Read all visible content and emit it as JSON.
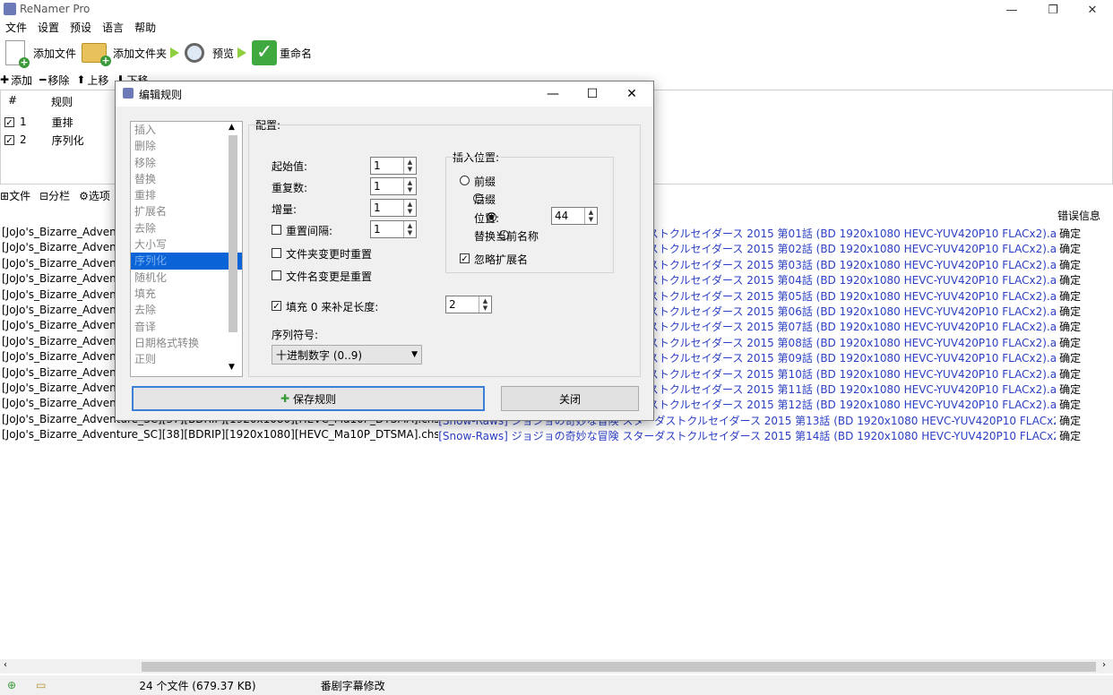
{
  "window": {
    "title": "ReNamer Pro"
  },
  "menu": [
    "文件",
    "设置",
    "预设",
    "语言",
    "帮助"
  ],
  "toolbar": {
    "add_files": "添加文件",
    "add_folder": "添加文件夹",
    "preview": "预览",
    "rename": "重命名"
  },
  "rules_toolbar": {
    "add": "添加",
    "remove": "移除",
    "up": "上移",
    "down": "下移"
  },
  "rules_table": {
    "col_num": "#",
    "col_rule": "规则",
    "rows": [
      {
        "num": "1",
        "rule": "重排"
      },
      {
        "num": "2",
        "rule": "序列化"
      }
    ]
  },
  "files_toolbar": {
    "files": "文件",
    "columns": "分栏",
    "options": "选项"
  },
  "files_table": {
    "col_error": "错误信息",
    "rows": [
      {
        "old": "[JoJo's_Bizarre_Advent",
        "new": "ストクルセイダース 2015 第01話 (BD 1920x1080 HEVC-YUV420P10 FLACx2).ass",
        "status": "确定"
      },
      {
        "old": "[JoJo's_Bizarre_Advent",
        "new": "ストクルセイダース 2015 第02話 (BD 1920x1080 HEVC-YUV420P10 FLACx2).ass",
        "status": "确定"
      },
      {
        "old": "[JoJo's_Bizarre_Advent",
        "new": "ストクルセイダース 2015 第03話 (BD 1920x1080 HEVC-YUV420P10 FLACx2).ass",
        "status": "确定"
      },
      {
        "old": "[JoJo's_Bizarre_Advent",
        "new": "ストクルセイダース 2015 第04話 (BD 1920x1080 HEVC-YUV420P10 FLACx2).ass",
        "status": "确定"
      },
      {
        "old": "[JoJo's_Bizarre_Advent",
        "new": "ストクルセイダース 2015 第05話 (BD 1920x1080 HEVC-YUV420P10 FLACx2).ass",
        "status": "确定"
      },
      {
        "old": "[JoJo's_Bizarre_Advent",
        "new": "ストクルセイダース 2015 第06話 (BD 1920x1080 HEVC-YUV420P10 FLACx2).ass",
        "status": "确定"
      },
      {
        "old": "[JoJo's_Bizarre_Advent",
        "new": "ストクルセイダース 2015 第07話 (BD 1920x1080 HEVC-YUV420P10 FLACx2).ass",
        "status": "确定"
      },
      {
        "old": "[JoJo's_Bizarre_Advent",
        "new": "ストクルセイダース 2015 第08話 (BD 1920x1080 HEVC-YUV420P10 FLACx2).ass",
        "status": "确定"
      },
      {
        "old": "[JoJo's_Bizarre_Advent",
        "new": "ストクルセイダース 2015 第09話 (BD 1920x1080 HEVC-YUV420P10 FLACx2).ass",
        "status": "确定"
      },
      {
        "old": "[JoJo's_Bizarre_Advent",
        "new": "ストクルセイダース 2015 第10話 (BD 1920x1080 HEVC-YUV420P10 FLACx2).ass",
        "status": "确定"
      },
      {
        "old": "[JoJo's_Bizarre_Advent",
        "new": "ストクルセイダース 2015 第11話 (BD 1920x1080 HEVC-YUV420P10 FLACx2).ass",
        "status": "确定"
      },
      {
        "old": "[JoJo's_Bizarre_Advent",
        "new": "ストクルセイダース 2015 第12話 (BD 1920x1080 HEVC-YUV420P10 FLACx2).ass",
        "status": "确定"
      },
      {
        "old": "[JoJo's_Bizarre_Adventure_SC][37][BDRIP][1920x1080][HEVC_Ma10P_DTSMA].chs.ass",
        "new": "[Snow-Raws] ジョジョの奇妙な冒険 スターダストクルセイダース 2015 第13話 (BD 1920x1080 HEVC-YUV420P10 FLACx2).ass",
        "status": "确定"
      },
      {
        "old": "[JoJo's_Bizarre_Adventure_SC][38][BDRIP][1920x1080][HEVC_Ma10P_DTSMA].chs.ass",
        "new": "[Snow-Raws] ジョジョの奇妙な冒険 スターダストクルセイダース 2015 第14話 (BD 1920x1080 HEVC-YUV420P10 FLACx2).ass",
        "status": "确定"
      }
    ]
  },
  "status_bar": {
    "count": "24 个文件 (679.37 KB)",
    "preset": "番剧字幕修改"
  },
  "dialog": {
    "title": "编辑规则",
    "rule_list": [
      "插入",
      "删除",
      "移除",
      "替换",
      "重排",
      "扩展名",
      "去除",
      "大小写",
      "序列化",
      "随机化",
      "填充",
      "去除",
      "音译",
      "日期格式转换",
      "正则"
    ],
    "selected_rule": "序列化",
    "config_title": "配置:",
    "start_label": "起始值:",
    "start_value": "1",
    "repeat_label": "重复数:",
    "repeat_value": "1",
    "step_label": "增量:",
    "step_value": "1",
    "reset_every_label": "重置间隔:",
    "reset_every_value": "1",
    "reset_folder_label": "文件夹变更时重置",
    "reset_name_label": "文件名变更是重置",
    "pad_label": "填充 0 来补足长度:",
    "pad_value": "2",
    "numbering_label": "序列符号:",
    "numbering_value": "十进制数字 (0..9)",
    "insert_title": "插入位置:",
    "opt_prefix": "前缀",
    "opt_suffix": "后缀",
    "opt_position": "位置:",
    "position_value": "44",
    "opt_replace": "替换当前名称",
    "ignore_ext": "忽略扩展名",
    "save_btn": "保存规则",
    "close_btn": "关闭"
  }
}
